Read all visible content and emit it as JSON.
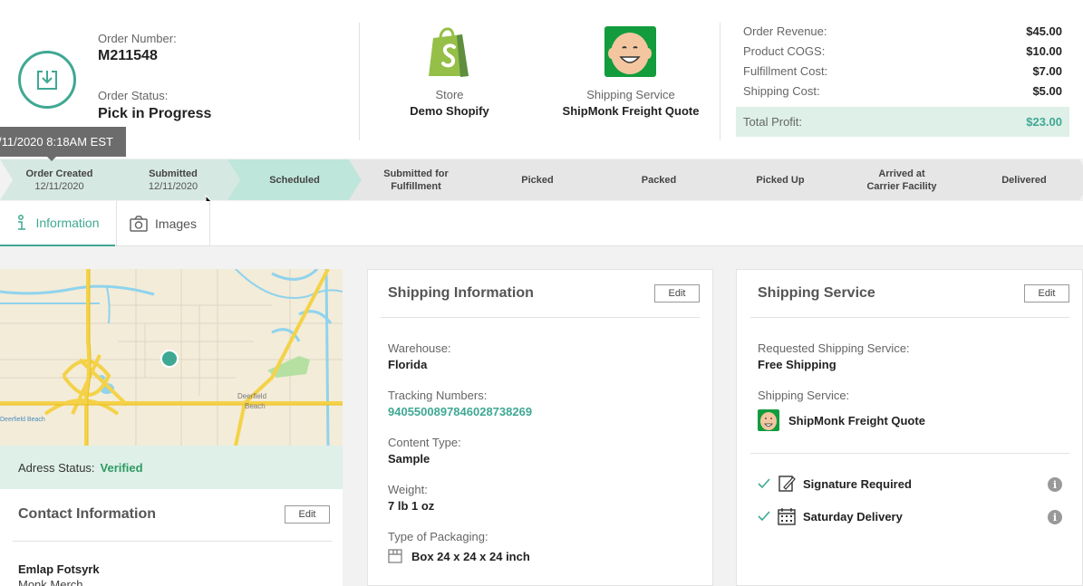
{
  "header": {
    "order_number_label": "Order Number:",
    "order_number": "M211548",
    "order_status_label": "Order Status:",
    "order_status": "Pick in Progress",
    "store_label": "Store",
    "store_name": "Demo Shopify",
    "shipping_label": "Shipping Service",
    "shipping_name": "ShipMonk Freight Quote",
    "financials": [
      {
        "label": "Order Revenue:",
        "value": "$45.00"
      },
      {
        "label": "Product COGS:",
        "value": "$10.00"
      },
      {
        "label": "Fulfillment Cost:",
        "value": "$7.00"
      },
      {
        "label": "Shipping Cost:",
        "value": "$5.00"
      }
    ],
    "total_profit_label": "Total Profit:",
    "total_profit": "$23.00"
  },
  "tooltip": "/11/2020 8:18AM EST",
  "progress": [
    {
      "label": "Order Created",
      "date": "12/11/2020",
      "state": "done"
    },
    {
      "label": "Submitted",
      "date": "12/11/2020",
      "state": "done"
    },
    {
      "label": "Scheduled",
      "date": "",
      "state": "current"
    },
    {
      "label": "Submitted for Fulfillment",
      "date": "",
      "state": "todo"
    },
    {
      "label": "Picked",
      "date": "",
      "state": "todo"
    },
    {
      "label": "Packed",
      "date": "",
      "state": "todo"
    },
    {
      "label": "Picked Up",
      "date": "",
      "state": "todo"
    },
    {
      "label": "Arrived at Carrier Facility",
      "date": "",
      "state": "todo"
    },
    {
      "label": "Delivered",
      "date": "",
      "state": "todo"
    }
  ],
  "tabs": [
    {
      "label": "Information",
      "icon": "info-person-icon",
      "active": true
    },
    {
      "label": "Images",
      "icon": "camera-icon",
      "active": false
    }
  ],
  "map": {
    "labels": [
      "Deerfield",
      "Beach",
      "Deerfield Beach"
    ],
    "address_status_label": "Adress Status:",
    "address_status": "Verified"
  },
  "contact": {
    "title": "Contact Information",
    "edit_label": "Edit",
    "name": "Emlap Fotsyrk",
    "company": "Monk Merch"
  },
  "shipping_info": {
    "title": "Shipping Information",
    "edit_label": "Edit",
    "warehouse_label": "Warehouse:",
    "warehouse": "Florida",
    "tracking_label": "Tracking Numbers:",
    "tracking": "9405500897846028738269",
    "content_label": "Content Type:",
    "content": "Sample",
    "weight_label": "Weight:",
    "weight": "7 lb 1 oz",
    "packaging_label": "Type of Packaging:",
    "packaging": "Box 24 x 24 x 24 inch"
  },
  "shipping_service": {
    "title": "Shipping Service",
    "edit_label": "Edit",
    "requested_label": "Requested Shipping Service:",
    "requested": "Free Shipping",
    "service_label": "Shipping Service:",
    "service": "ShipMonk Freight Quote",
    "options": [
      {
        "label": "Signature Required",
        "icon": "signature-icon"
      },
      {
        "label": "Saturday Delivery",
        "icon": "calendar-icon"
      }
    ]
  },
  "colors": {
    "accent": "#3fa893",
    "verified": "#2e9a63",
    "step_done": "#d6e8e2",
    "step_current": "#bfe6da",
    "step_todo": "#e6e6e6",
    "profit_bg": "#def0e8"
  }
}
